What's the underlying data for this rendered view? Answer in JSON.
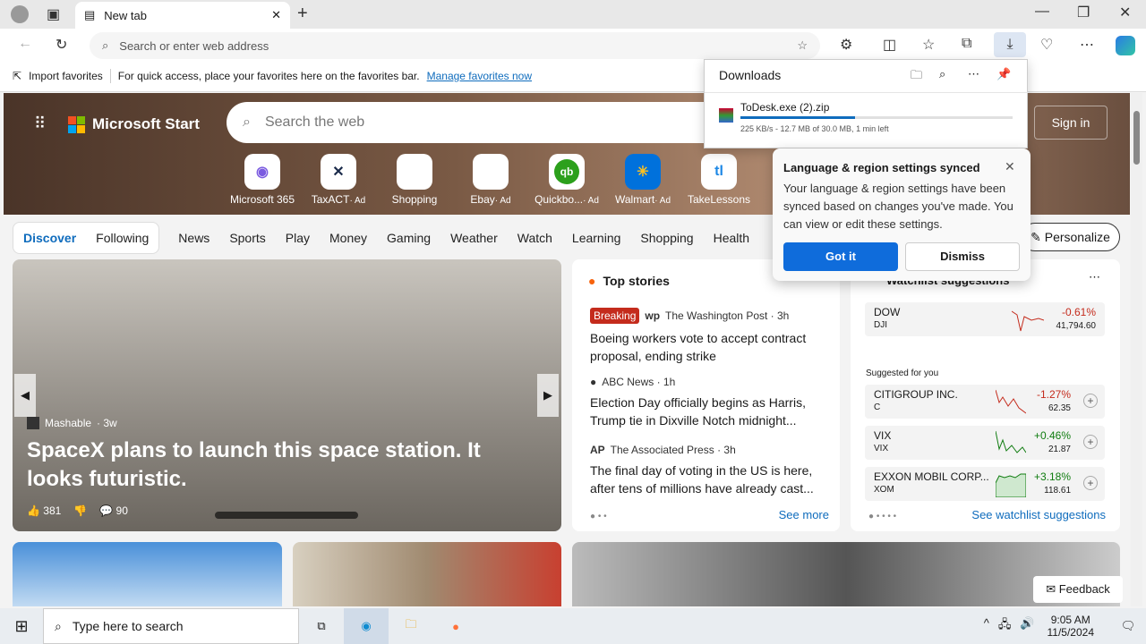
{
  "browser": {
    "tab_title": "New tab",
    "address_placeholder": "Search or enter web address"
  },
  "favorites": {
    "import": "Import favorites",
    "hint": "For quick access, place your favorites here on the favorites bar.",
    "manage": "Manage favorites now"
  },
  "downloads": {
    "title": "Downloads",
    "file": "ToDesk.exe (2).zip",
    "status": "225 KB/s - 12.7 MB of 30.0 MB, 1 min left",
    "progress": 0.42
  },
  "popup": {
    "title": "Language & region settings synced",
    "body": "Your language & region settings have been synced based on changes you've made. You can view or edit these settings.",
    "ok": "Got it",
    "dismiss": "Dismiss"
  },
  "page": {
    "brand": "Microsoft Start",
    "search_placeholder": "Search the web",
    "sign_in": "Sign in",
    "quick_links": [
      {
        "label": "Microsoft 365",
        "ad": ""
      },
      {
        "label": "TaxACT",
        "ad": "· Ad"
      },
      {
        "label": "Shopping",
        "ad": ""
      },
      {
        "label": "Ebay",
        "ad": "· Ad"
      },
      {
        "label": "Quickbo...",
        "ad": "· Ad"
      },
      {
        "label": "Walmart",
        "ad": "· Ad"
      },
      {
        "label": "TakeLessons",
        "ad": ""
      }
    ],
    "nav": [
      "Discover",
      "Following",
      "News",
      "Sports",
      "Play",
      "Money",
      "Gaming",
      "Weather",
      "Watch",
      "Learning",
      "Shopping",
      "Health"
    ],
    "personalize": "Personalize",
    "hero": {
      "source": "Mashable",
      "age": "· 3w",
      "title": "SpaceX plans to launch this space station. It looks futuristic.",
      "likes": "381",
      "comments": "90"
    },
    "top_stories": {
      "title": "Top stories",
      "breaking": "Breaking",
      "see_more": "See more",
      "items": [
        {
          "source": "The Washington Post · 3h",
          "headline": "Boeing workers vote to accept contract proposal, ending strike"
        },
        {
          "source": "ABC News · 1h",
          "headline": "Election Day officially begins as Harris, Trump tie in Dixville Notch midnight..."
        },
        {
          "source": "The Associated Press · 3h",
          "headline": "The final day of voting in the US is here, after tens of millions have already cast..."
        }
      ]
    },
    "watchlist": {
      "title": "Watchlist suggestions",
      "suggested": "Suggested for you",
      "see_all": "See watchlist suggestions",
      "index": {
        "name": "DOW",
        "symbol": "DJI",
        "change": "-0.61%",
        "value": "41,794.60"
      },
      "stocks": [
        {
          "name": "CITIGROUP INC.",
          "symbol": "C",
          "change": "-1.27%",
          "value": "62.35",
          "dir": "down"
        },
        {
          "name": "VIX",
          "symbol": "VIX",
          "change": "+0.46%",
          "value": "21.87",
          "dir": "up"
        },
        {
          "name": "EXXON MOBIL CORP...",
          "symbol": "XOM",
          "change": "+3.18%",
          "value": "118.61",
          "dir": "up"
        }
      ]
    },
    "feedback": "Feedback"
  },
  "taskbar": {
    "search_placeholder": "Type here to search",
    "time": "9:05 AM",
    "date": "11/5/2024"
  }
}
